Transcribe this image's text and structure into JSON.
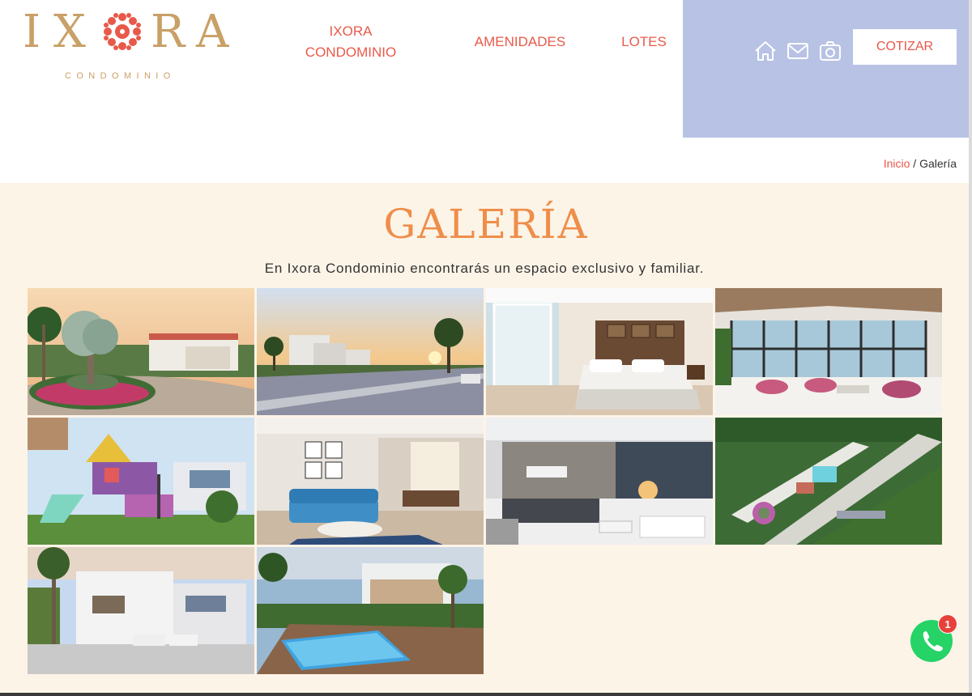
{
  "logo": {
    "letters": [
      "I",
      "X",
      "R",
      "A"
    ],
    "flower_icon": "ixora-flower-icon",
    "subtitle": "CONDOMINIO",
    "color": "#c9a067"
  },
  "nav": {
    "items": [
      {
        "line1": "IXORA",
        "line2": "CONDOMINIO"
      },
      {
        "label": "AMENIDADES"
      },
      {
        "label": "LOTES"
      }
    ],
    "color": "#e8594a"
  },
  "header_actions": {
    "icons": [
      "home-icon",
      "mail-icon",
      "camera-icon"
    ],
    "cotizar_label": "COTIZAR",
    "panel_color": "#b7c2e4"
  },
  "breadcrumb": {
    "home": "Inicio",
    "separator": " / ",
    "current": "Galería"
  },
  "page": {
    "title": "GALERÍA",
    "subtitle": "En Ixora Condominio encontrarás un espacio exclusivo y familiar.",
    "title_color": "#ee8e4a",
    "background": "#fdf4e8"
  },
  "gallery": {
    "images": [
      "entrance-roundabout-photo",
      "street-sunset-photo",
      "bedroom-photo",
      "lobby-lounge-photo",
      "playground-photo",
      "living-room-photo",
      "reception-photo",
      "aerial-view-photo",
      "house-facade-photo",
      "pool-deck-photo"
    ]
  },
  "whatsapp": {
    "icon": "whatsapp-icon",
    "badge_count": "1",
    "color": "#25d366"
  }
}
